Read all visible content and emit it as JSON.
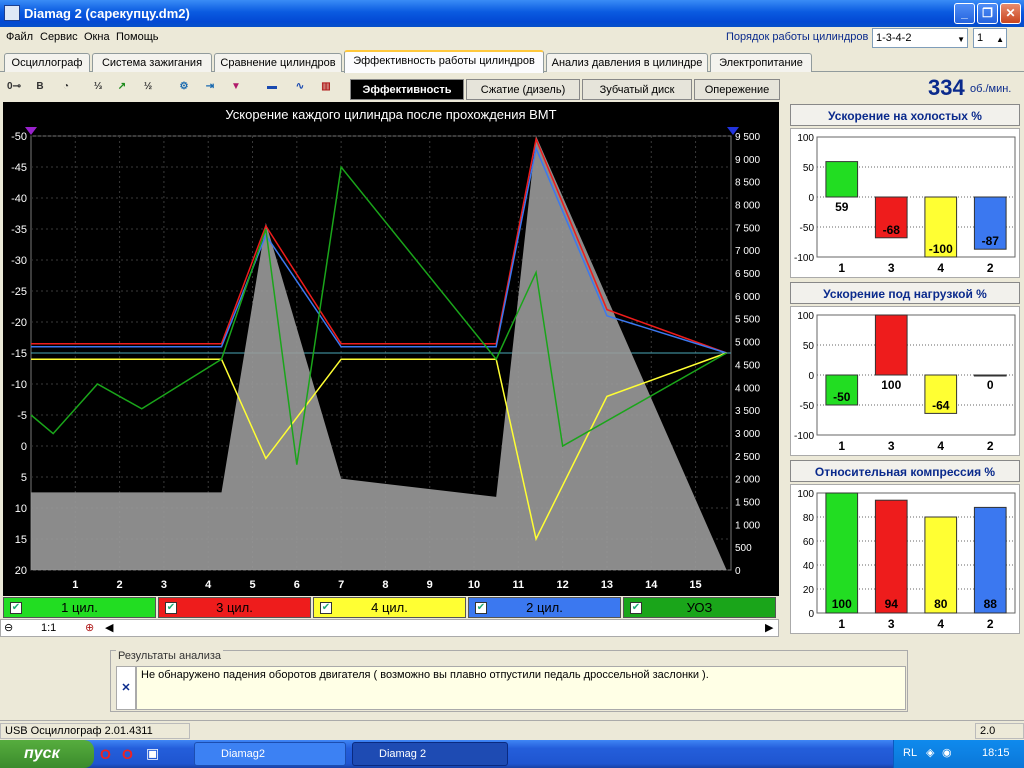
{
  "window": {
    "title": "Diamag 2 (сарекупцу.dm2)"
  },
  "menu": [
    "Файл",
    "Сервис",
    "Окна",
    "Помощь"
  ],
  "firing": {
    "label": "Порядок работы цилиндров",
    "order": "1-3-4-2",
    "cylinder": "1"
  },
  "tabs": [
    "Осциллограф",
    "Система зажигания",
    "Сравнение цилиндров",
    "Эффективность работы цилиндров",
    "Анализ давления в цилиндре",
    "Электропитание"
  ],
  "active_tab": 3,
  "subtabs": [
    "Эффективность",
    "Сжатие (дизель)",
    "Зубчатый диск",
    "Опережение"
  ],
  "toolbar_icons": [
    "oscilloscope-icon",
    "bold-icon",
    "rpm-icon",
    "number-order-icon",
    "trend-icon",
    "algorithm-icon",
    "settings-icon",
    "export-icon",
    "filter-icon",
    "cars-icon",
    "graph-icon",
    "cylinder-gauge-icon"
  ],
  "rpm": {
    "value": "334",
    "unit": "об./мин."
  },
  "chart": {
    "title": "Ускорение каждого цилиндра после прохождения ВМТ",
    "left_ticks": [
      "-50",
      "-45",
      "-40",
      "-35",
      "-30",
      "-25",
      "-20",
      "-15",
      "-10",
      "-5",
      "0",
      "5",
      "10",
      "15",
      "20"
    ],
    "right_ticks": [
      "9 500",
      "9 000",
      "8 500",
      "8 000",
      "7 500",
      "7 000",
      "6 500",
      "6 000",
      "5 500",
      "5 000",
      "4 500",
      "4 000",
      "3 500",
      "3 000",
      "2 500",
      "2 000",
      "1 500",
      "1 000",
      "500",
      "0"
    ],
    "x_ticks": [
      "1",
      "2",
      "3",
      "4",
      "5",
      "6",
      "7",
      "8",
      "9",
      "10",
      "11",
      "12",
      "13",
      "14",
      "15"
    ]
  },
  "channels": [
    {
      "label": "1 цил.",
      "color": "#22dd22"
    },
    {
      "label": "3 цил.",
      "color": "#ee1c1c"
    },
    {
      "label": "4 цил.",
      "color": "#ffff33"
    },
    {
      "label": "2 цил.",
      "color": "#3b78f0"
    },
    {
      "label": "УОЗ",
      "color": "#1aa51a"
    }
  ],
  "zoom": "1:1",
  "chart_data": [
    {
      "type": "line",
      "title": "Ускорение каждого цилиндра после прохождения ВМТ",
      "x_ticks": [
        1,
        2,
        3,
        4,
        5,
        6,
        7,
        8,
        9,
        10,
        11,
        12,
        13,
        14,
        15
      ],
      "ylim_left": [
        20,
        -50
      ],
      "ylim_right": [
        0,
        9500
      ],
      "series": [
        {
          "name": "3 цил.",
          "color": "#ee1c1c",
          "x": [
            0,
            4.3,
            5.3,
            7,
            10.5,
            11.4,
            13,
            15.7
          ],
          "y": [
            -16.5,
            -16.5,
            -35.5,
            -16.5,
            -16.5,
            -49.5,
            -22,
            -15
          ]
        },
        {
          "name": "2 цил.",
          "color": "#3b78f0",
          "x": [
            0,
            4.3,
            5.3,
            7,
            10.5,
            11.4,
            13,
            15.7
          ],
          "y": [
            -16,
            -16,
            -34,
            -16,
            -16,
            -48,
            -21,
            -15
          ]
        },
        {
          "name": "4 цил.",
          "color": "#ffff33",
          "x": [
            0,
            4.3,
            5.3,
            7,
            10.5,
            11.4,
            13,
            15.7
          ],
          "y": [
            -14,
            -14,
            2,
            -14,
            -14,
            15,
            -8,
            -15
          ]
        },
        {
          "name": "УОЗ",
          "color": "#1aa51a",
          "x": [
            0,
            0.5,
            1.5,
            2.5,
            4.3,
            5.3,
            6,
            7,
            10.5,
            11.4,
            12,
            15.7
          ],
          "y": [
            -5,
            -2,
            -10,
            -6,
            -14,
            -35,
            3,
            -45,
            -14,
            -28,
            0,
            -15
          ]
        },
        {
          "name": "обороты",
          "color": "#a0a0a0",
          "x": [
            0,
            4.3,
            5.3,
            7,
            10.5,
            11.4,
            15.7
          ],
          "y": [
            1700,
            1700,
            7600,
            2000,
            1600,
            9500,
            0
          ]
        }
      ]
    },
    {
      "type": "bar",
      "title": "Ускорение на холостых %",
      "categories": [
        "1",
        "3",
        "4",
        "2"
      ],
      "values": [
        59,
        -68,
        -100,
        -87
      ],
      "ylim": [
        -100,
        100
      ],
      "yticks": [
        100,
        50,
        0,
        -50,
        -100
      ],
      "colors": [
        "#22dd22",
        "#ee1c1c",
        "#ffff33",
        "#3b78f0"
      ]
    },
    {
      "type": "bar",
      "title": "Ускорение под нагрузкой %",
      "categories": [
        "1",
        "3",
        "4",
        "2"
      ],
      "values": [
        -50,
        100,
        -64,
        0
      ],
      "ylim": [
        -100,
        100
      ],
      "yticks": [
        100,
        50,
        0,
        -50,
        -100
      ],
      "colors": [
        "#22dd22",
        "#ee1c1c",
        "#ffff33",
        "#3b78f0"
      ]
    },
    {
      "type": "bar",
      "title": "Относительная компрессия %",
      "categories": [
        "1",
        "3",
        "4",
        "2"
      ],
      "values": [
        100,
        94,
        80,
        88
      ],
      "ylim": [
        0,
        100
      ],
      "yticks": [
        100,
        80,
        60,
        40,
        20,
        0
      ],
      "colors": [
        "#22dd22",
        "#ee1c1c",
        "#ffff33",
        "#3b78f0"
      ]
    }
  ],
  "analysis": {
    "label": "Результаты анализа",
    "text": "Не обнаружено падения оборотов двигателя ( возможно вы плавно отпустили педаль дроссельной заслонки )."
  },
  "status": {
    "left": "USB Осциллограф  2.01.4311",
    "right": "2.0"
  },
  "taskbar": {
    "start": "пуск",
    "items": [
      "Diamag2",
      "Diamag 2"
    ],
    "lang": "RL",
    "time": "18:15"
  }
}
